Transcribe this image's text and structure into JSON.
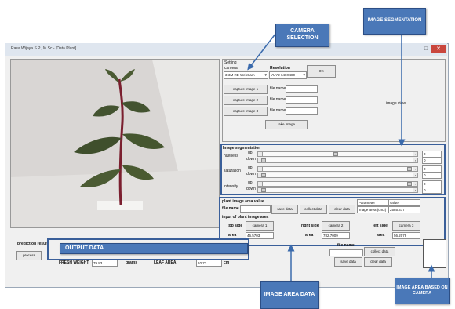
{
  "window": {
    "title": "Rasa Wijaya S.P., M.Sc - [Data Plant]",
    "min": "–",
    "max": "□",
    "close": "✕"
  },
  "setting": {
    "title": "Setting",
    "camera_label": "camera",
    "camera_value": "3-3M RE WebCam",
    "resolution_label": "Resolution",
    "resolution_value": "YUY2 640X480",
    "ok": "OK",
    "capture1": "capture image 1",
    "capture2": "capture image 2",
    "capture3": "capture image 3",
    "file_name": "file name",
    "take_image": "take image",
    "image_view": "image view"
  },
  "segmentation": {
    "title": "Image segmentation",
    "hueness": "hueness",
    "saturation": "saturation",
    "intensity": "intensity",
    "upper": "up",
    "lower": "down",
    "values": [
      "0",
      "0",
      "0",
      "0",
      "0",
      "0"
    ]
  },
  "area_value": {
    "title": "plant image area value",
    "file_name": "file name",
    "save_data": "save data",
    "collect_data": "collect data",
    "clear_data": "clear data",
    "param_header": "Parameter",
    "value_header": "value",
    "param_row": "image area (cm2)",
    "value_row": "2585.477"
  },
  "input_area": {
    "title": "input of plant image area",
    "top_side": "top side",
    "right_side": "right side",
    "left_side": "left side",
    "camera1": "camera 1",
    "camera2": "camera 2",
    "camera3": "camera 3",
    "area": "area",
    "area1": "46.5703",
    "area2": "782.7009",
    "area3": "56.2079"
  },
  "prediction": {
    "title": "prediction results",
    "process": "process",
    "fresh_weight": "FRESH WEIGHT",
    "fresh_value": "79.83",
    "grams": "grams",
    "leaf_area": "LEAF AREA",
    "leaf_value": "10.73",
    "unit": "cm"
  },
  "bottom_right": {
    "file_name": "file name",
    "collect_data": "collect data",
    "save_data": "save data",
    "clear_data": "clear data"
  },
  "callouts": {
    "camera_selection": "CAMERA SELECTION",
    "image_segmentation": "IMAGE SEGMENTATION",
    "output_data": "OUTPUT DATA",
    "image_area_data": "IMAGE AREA DATA",
    "image_area_based": "IMAGE AREA BASED ON CAMERA"
  },
  "colors": {
    "callout": "#4a78b8",
    "outline": "#3a5f9a"
  }
}
